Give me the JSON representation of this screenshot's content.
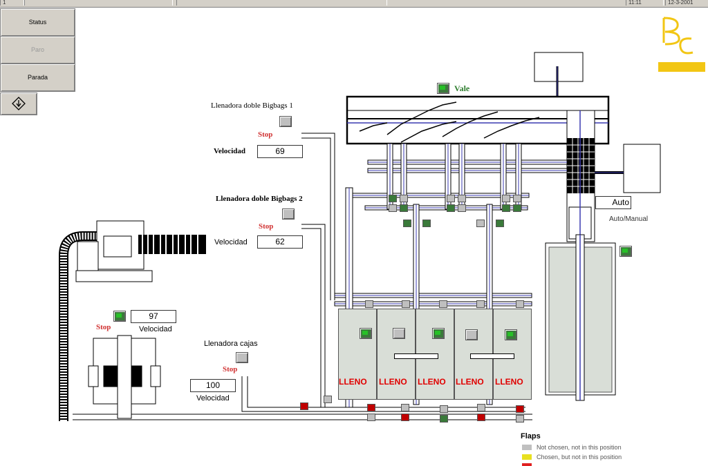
{
  "topbar": {
    "cell1": "1",
    "cell2": "",
    "cell3": "",
    "time": "11:11",
    "date": "12-3-2001"
  },
  "sidebar": {
    "status_label": "Status",
    "paro_label": "Paro",
    "parada_label": "Parada",
    "icon": "diamond-arrow-icon"
  },
  "logo": {
    "text": "BC",
    "color": "#f2c614"
  },
  "vale_label": "Vale",
  "filler1": {
    "title": "Llenadora doble Bigbags 1",
    "stop": "Stop",
    "speed_label": "Velocidad",
    "speed": "69"
  },
  "filler2": {
    "title": "Llenadora doble Bigbags 2",
    "stop": "Stop",
    "speed_label": "Velocidad",
    "speed": "62"
  },
  "filler3": {
    "stop": "Stop",
    "speed_label": "Velocidad",
    "speed": "97"
  },
  "filler_boxes": {
    "title": "Llenadora cajas",
    "stop": "Stop",
    "speed_label": "Velocidad",
    "speed": "100"
  },
  "mode": {
    "value": "Auto",
    "label": "Auto/Manual"
  },
  "silos": [
    "LLENO",
    "LLENO",
    "LLENO",
    "LLENO",
    "LLENO"
  ],
  "legend": {
    "title": "Flaps",
    "items": [
      {
        "text": "Not chosen, not in this position",
        "color": "#c0c0c0"
      },
      {
        "text": "Chosen, but not in this position",
        "color": "#e8e020"
      },
      {
        "text": "",
        "color": "#e02020"
      }
    ]
  },
  "colors": {
    "pipe_blue": "#3a3ab0",
    "alarm_red": "#d03030",
    "ok_green": "#27c027"
  }
}
